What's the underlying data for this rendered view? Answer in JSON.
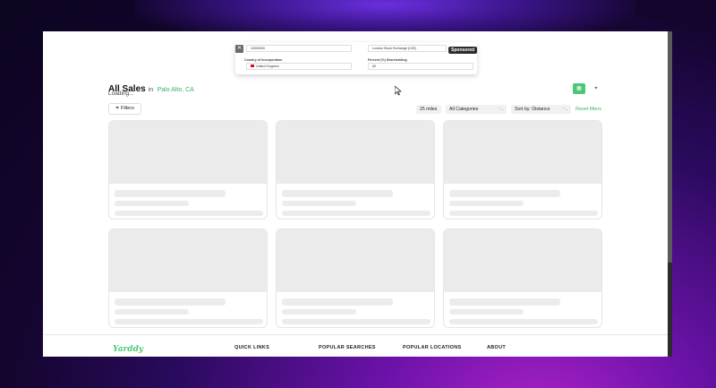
{
  "ad": {
    "close_glyph": "✕",
    "top_left_field": "10000000",
    "top_right_field": "London Stock Exchange (LSE)",
    "country_label": "Country of Incorporation",
    "country_value": "United Kingdom",
    "percent_label": "Percent (%) Shareholding",
    "percent_value": "60",
    "sponsored": "Sponsored"
  },
  "header": {
    "title": "All Sales",
    "in_text": "in",
    "location": "Palo Alto, CA",
    "loading": "Loading..."
  },
  "toolbar": {
    "filters_label": "Filters",
    "filter_icon": "⏷",
    "distance": "25 miles",
    "category": "All Categories",
    "sort": "Sort by: Distance",
    "reset": "Reset filters",
    "grid_icon": "▦",
    "map_icon": "⌖",
    "chev": "⌃⌄"
  },
  "footer": {
    "logo": "Yarddy",
    "quick_links": "QUICK LINKS",
    "popular_searches": "POPULAR SEARCHES",
    "popular_locations": "POPULAR LOCATIONS",
    "about": "ABOUT"
  },
  "colors": {
    "accent": "#4cc776",
    "link": "#3bb068",
    "skeleton": "#ebebeb"
  }
}
